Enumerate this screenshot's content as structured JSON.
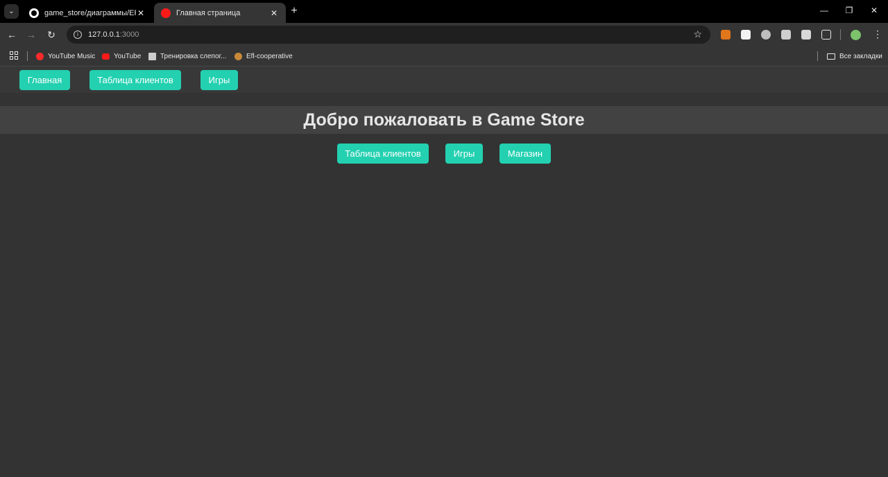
{
  "browser": {
    "tabs": [
      {
        "title": "game_store/диаграммы/ER_DIA",
        "favicon": "github-icon"
      },
      {
        "title": "Главная страница",
        "favicon": "red-circle-icon"
      }
    ],
    "url_host": "127.0.0.1",
    "url_port": ":3000",
    "bookmarks": [
      {
        "label": "YouTube Music",
        "icon": "youtube-music-icon"
      },
      {
        "label": "YouTube",
        "icon": "youtube-icon"
      },
      {
        "label": "Тренировка слепог...",
        "icon": "page-icon"
      },
      {
        "label": "Efl-cooperative",
        "icon": "globe-icon"
      }
    ],
    "all_bookmarks_label": "Все закладки"
  },
  "nav": {
    "items": [
      {
        "label": "Главная"
      },
      {
        "label": "Таблица клиентов"
      },
      {
        "label": "Игры"
      }
    ]
  },
  "hero": {
    "title": "Добро пожаловать в Game Store"
  },
  "main_links": [
    {
      "label": "Таблица клиентов"
    },
    {
      "label": "Игры"
    },
    {
      "label": "Магазин"
    }
  ],
  "colors": {
    "accent": "#23d0b0",
    "background": "#333333",
    "hero_bg": "#424242"
  }
}
